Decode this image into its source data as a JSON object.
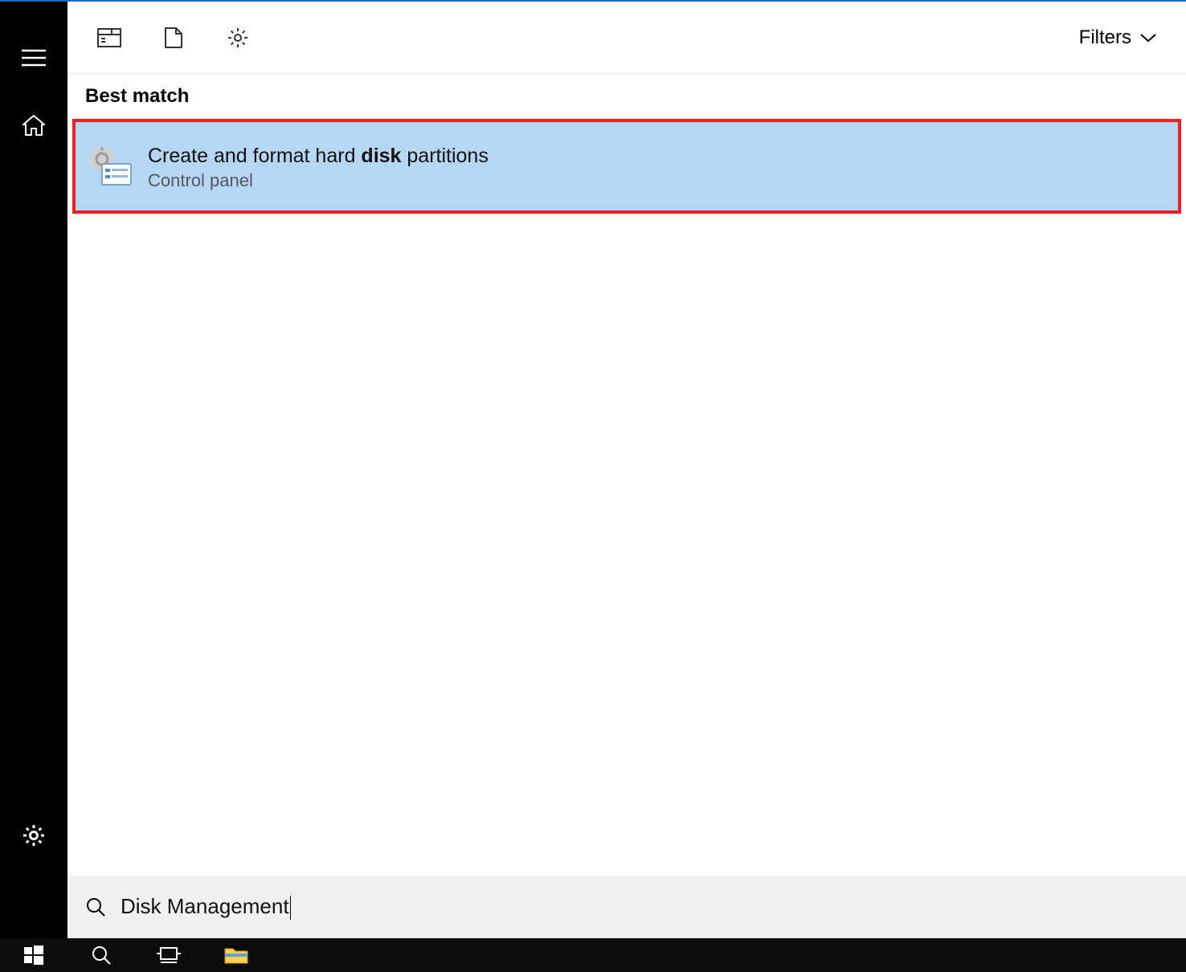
{
  "filters": {
    "label": "Filters"
  },
  "section": {
    "best_match": "Best match"
  },
  "result": {
    "title_pre": "Create and format hard ",
    "title_bold": "disk",
    "title_post": " partitions",
    "subtitle": "Control panel"
  },
  "search": {
    "query": "Disk Management"
  }
}
